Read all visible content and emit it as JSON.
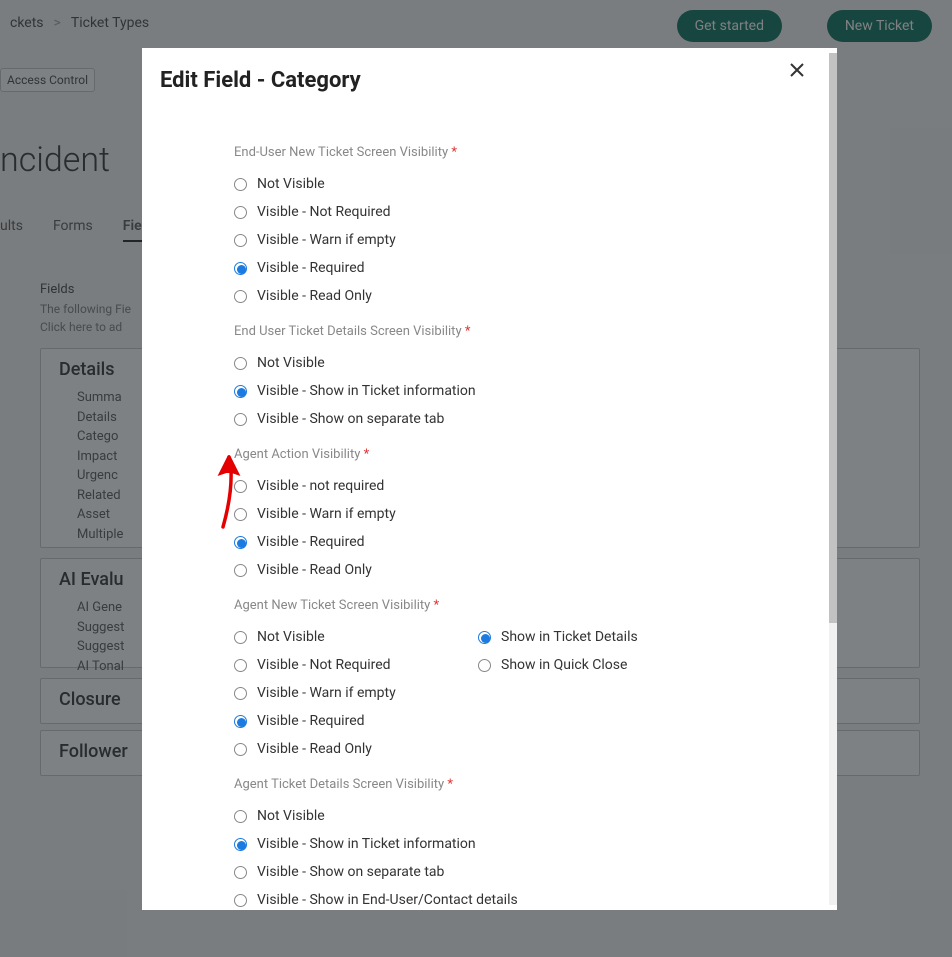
{
  "background": {
    "breadcrumb": {
      "a": "ckets",
      "sep": ">",
      "b": "Ticket Types"
    },
    "buttons": {
      "get_started": "Get started",
      "new_ticket": "New Ticket"
    },
    "pill": "Access Control",
    "title": "ncident",
    "tabs": {
      "a": "ults",
      "b": "Forms",
      "c": "Fiel"
    },
    "fields_note": {
      "hd": "Fields",
      "l1": "The following Fie",
      "l2": "Click here to ad"
    },
    "card_details": {
      "title": "Details",
      "items": [
        "Summa",
        "Details",
        "Catego",
        "Impact",
        "Urgenc",
        "Related",
        "Asset",
        "Multiple"
      ]
    },
    "card_ai": {
      "title": "AI Evalu",
      "items": [
        "AI Gene",
        "Suggest",
        "Suggest",
        "AI Tonal"
      ]
    },
    "card_closure": {
      "title": "Closure"
    },
    "card_followers": {
      "title": "Follower"
    }
  },
  "modal": {
    "title": "Edit Field - Category",
    "groups": {
      "eu_new": {
        "label": "End-User New Ticket Screen Visibility",
        "required": true,
        "options": [
          "Not Visible",
          "Visible - Not Required",
          "Visible - Warn if empty",
          "Visible - Required",
          "Visible - Read Only"
        ],
        "selected": 3
      },
      "eu_details": {
        "label": "End User Ticket Details Screen Visibility",
        "required": true,
        "options": [
          "Not Visible",
          "Visible - Show in Ticket information",
          "Visible - Show on separate tab"
        ],
        "selected": 1
      },
      "agent_action": {
        "label": "Agent Action Visibility",
        "required": true,
        "options": [
          "Visible - not required",
          "Visible - Warn if empty",
          "Visible - Required",
          "Visible - Read Only"
        ],
        "selected": 2
      },
      "agent_new": {
        "label": "Agent New Ticket Screen Visibility",
        "required": true,
        "left_options": [
          "Not Visible",
          "Visible - Not Required",
          "Visible - Warn if empty",
          "Visible - Required",
          "Visible - Read Only"
        ],
        "left_selected": 3,
        "right_options": [
          "Show in Ticket Details",
          "Show in Quick Close"
        ],
        "right_selected": 0
      },
      "agent_details": {
        "label": "Agent Ticket Details Screen Visibility",
        "required": true,
        "options": [
          "Not Visible",
          "Visible - Show in Ticket information",
          "Visible - Show on separate tab",
          "Visible - Show in End-User/Contact details"
        ],
        "selected": 1
      }
    }
  }
}
